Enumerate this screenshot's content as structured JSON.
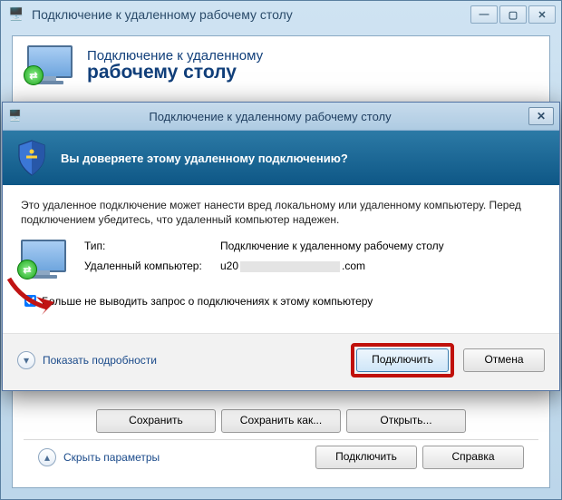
{
  "back": {
    "title": "Подключение к удаленному рабочему столу",
    "h1": "Подключение к удаленному",
    "h2": "рабочему столу",
    "buttons": {
      "save": "Сохранить",
      "saveAs": "Сохранить как...",
      "open": "Открыть..."
    },
    "hideParams": "Скрыть параметры",
    "connect": "Подключить",
    "help": "Справка"
  },
  "dialog": {
    "title": "Подключение к удаленному рабочему столу",
    "question": "Вы доверяете этому удаленному подключению?",
    "desc": "Это удаленное подключение может нанести вред локальному или удаленному компьютеру. Перед подключением убедитесь, что удаленный компьютер надежен.",
    "labels": {
      "type": "Тип:",
      "typeVal": "Подключение к удаленному рабочему столу",
      "remote": "Удаленный компьютер:",
      "remotePrefix": "u20",
      "remoteSuffix": ".com"
    },
    "checkbox": "Больше не выводить запрос о подключениях к этому компьютеру",
    "details": "Показать подробности",
    "connect": "Подключить",
    "cancel": "Отмена"
  }
}
